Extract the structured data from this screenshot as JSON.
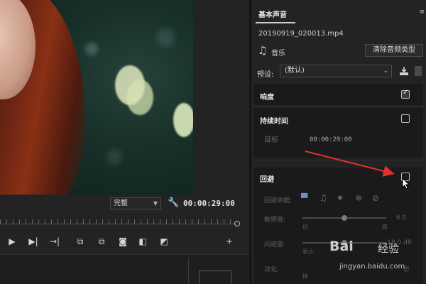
{
  "monitor": {
    "quality": "完整",
    "timecode": "00:00:29:00"
  },
  "panel": {
    "title": "基本声音",
    "clip_name": "20190919_020013.mp4",
    "type_label": "音乐",
    "clear_type_button": "清除音频类型",
    "preset_label": "预设:",
    "preset_value": "(默认)",
    "sections": {
      "loudness": {
        "title": "响度",
        "checked": true
      },
      "duration": {
        "title": "持续时间",
        "checked": false,
        "target_label": "目标",
        "target_time": "00:00:29:00"
      },
      "ducking": {
        "title": "回避",
        "checked": false,
        "ducking_against_label": "回避依据:",
        "sensitivity_label": "敏感度:",
        "sensitivity_value": "6.0",
        "sensitivity_low": "低",
        "sensitivity_high": "高",
        "sensitivity_level": 0.5,
        "reduction_label": "闪避量:",
        "reduction_value": "-18.0 dB",
        "reduction_low": "更小",
        "reduction_level": 0.5,
        "fade_label": "淡化:",
        "fade_low": "快",
        "fade_unit": "秒"
      }
    }
  },
  "watermark": {
    "brand": "Bai",
    "brand2": "经验",
    "url": "jingyan.baidu.com"
  },
  "colors": {
    "annotation_arrow": "#e0302a",
    "ducking_active_icon": "#6b8fc9"
  }
}
